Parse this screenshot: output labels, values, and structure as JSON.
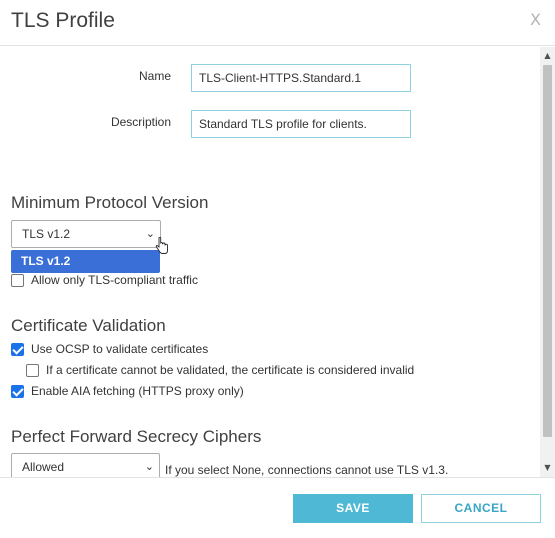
{
  "dialog": {
    "title": "TLS Profile",
    "close_glyph": "X"
  },
  "form": {
    "name_label": "Name",
    "name_value": "TLS-Client-HTTPS.Standard.1",
    "description_label": "Description",
    "description_value": "Standard TLS profile for clients."
  },
  "min_protocol": {
    "section_title": "Minimum Protocol Version",
    "selected": "TLS v1.2",
    "dropdown_options": [
      "TLS v1.2"
    ],
    "allow_tls_compliant_label": "Allow only TLS-compliant traffic",
    "allow_tls_compliant_checked": false
  },
  "cert_validation": {
    "section_title": "Certificate Validation",
    "ocsp_label": "Use OCSP to validate certificates",
    "ocsp_checked": true,
    "invalid_if_unvalidated_label": "If a certificate cannot be validated, the certificate is considered invalid",
    "invalid_if_unvalidated_checked": false,
    "aia_label": "Enable AIA fetching (HTTPS proxy only)",
    "aia_checked": true
  },
  "pfs": {
    "section_title": "Perfect Forward Secrecy Ciphers",
    "selected": "Allowed",
    "hint": "If you select None, connections cannot use TLS v1.3."
  },
  "footer": {
    "save_label": "SAVE",
    "cancel_label": "CANCEL"
  },
  "colors": {
    "accent": "#4fb8d4",
    "input_border": "#8fd3e2",
    "dropdown_highlight": "#3a6fd8",
    "checkbox_checked": "#1a73e8"
  },
  "icons": {
    "close": "close-icon",
    "select_chevron": "chevron-down-icon",
    "cursor": "hand-pointer-icon",
    "scroll_up": "arrow-up-icon",
    "scroll_down": "arrow-down-icon"
  }
}
